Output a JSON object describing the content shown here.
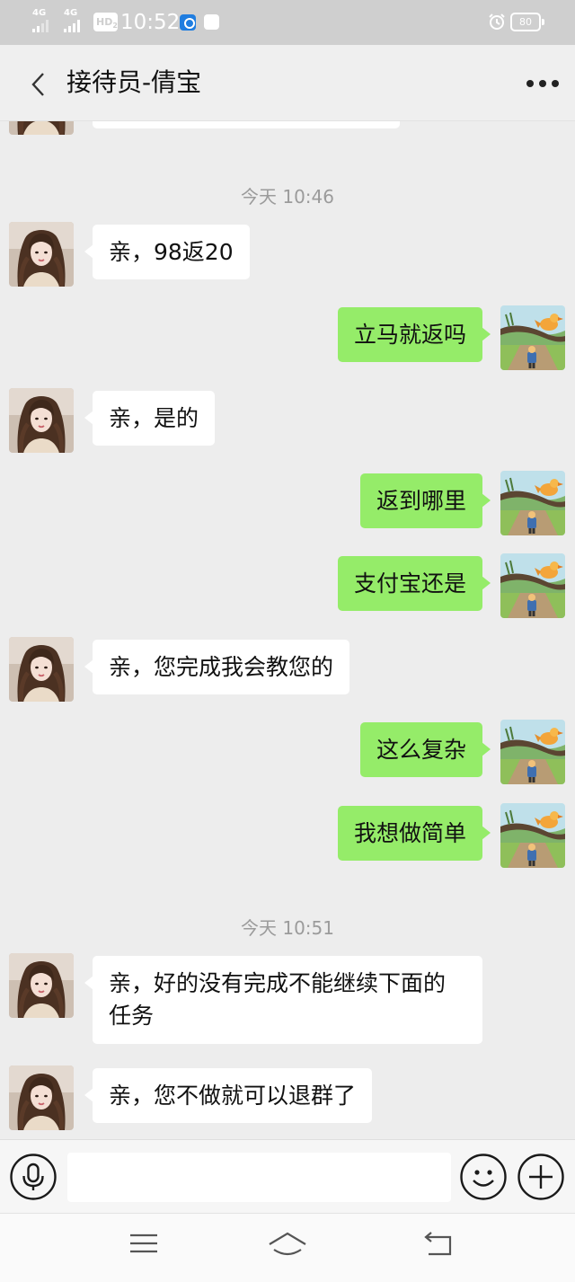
{
  "status_bar": {
    "net1": "4G",
    "net2": "4G",
    "hd": "HD",
    "hd_sub": "2",
    "time": "10:52",
    "battery": "80"
  },
  "header": {
    "title": "接待员-倩宝",
    "icons": [
      "back-chevron-icon",
      "more-icon"
    ]
  },
  "chat": {
    "timestamps": [
      "今天 10:46",
      "今天 10:51"
    ],
    "messages": [
      {
        "side": "left",
        "avatar": "girl-photo-avatar",
        "text": "亲，98返20"
      },
      {
        "side": "right",
        "avatar": "cartoon-bird-avatar",
        "text": "立马就返吗"
      },
      {
        "side": "left",
        "avatar": "girl-photo-avatar",
        "text": "亲，是的"
      },
      {
        "side": "right",
        "avatar": "cartoon-bird-avatar",
        "text": "返到哪里"
      },
      {
        "side": "right",
        "avatar": "cartoon-bird-avatar",
        "text": "支付宝还是"
      },
      {
        "side": "left",
        "avatar": "girl-photo-avatar",
        "text": "亲，您完成我会教您的"
      },
      {
        "side": "right",
        "avatar": "cartoon-bird-avatar",
        "text": "这么复杂"
      },
      {
        "side": "right",
        "avatar": "cartoon-bird-avatar",
        "text": "我想做简单"
      },
      {
        "side": "left",
        "avatar": "girl-photo-avatar",
        "text": "亲，好的没有完成不能继续下面的任务"
      },
      {
        "side": "left",
        "avatar": "girl-photo-avatar",
        "text": "亲，您不做就可以退群了"
      }
    ]
  },
  "input_bar": {
    "value": "",
    "icons": [
      "microphone-icon",
      "smiley-icon",
      "plus-icon"
    ]
  },
  "nav_bar": {
    "icons": [
      "menu-icon",
      "home-icon",
      "back-icon"
    ]
  },
  "colors": {
    "chat_background": "#ededed",
    "sent_bubble": "#95ec69",
    "received_bubble": "#ffffff",
    "status_bar": "#cfcfcf"
  }
}
